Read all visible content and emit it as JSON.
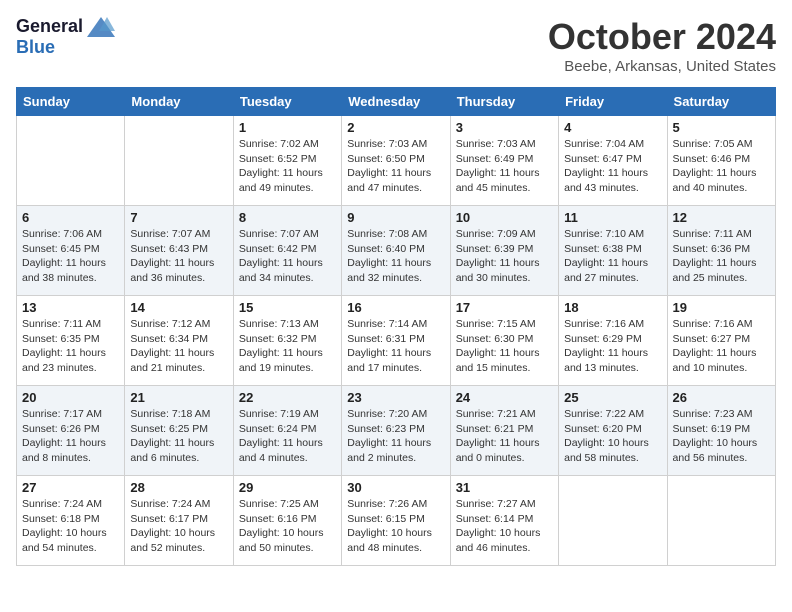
{
  "header": {
    "logo_general": "General",
    "logo_blue": "Blue",
    "month": "October 2024",
    "location": "Beebe, Arkansas, United States"
  },
  "days_of_week": [
    "Sunday",
    "Monday",
    "Tuesday",
    "Wednesday",
    "Thursday",
    "Friday",
    "Saturday"
  ],
  "weeks": [
    [
      {
        "day": "",
        "info": ""
      },
      {
        "day": "",
        "info": ""
      },
      {
        "day": "1",
        "info": "Sunrise: 7:02 AM\nSunset: 6:52 PM\nDaylight: 11 hours and 49 minutes."
      },
      {
        "day": "2",
        "info": "Sunrise: 7:03 AM\nSunset: 6:50 PM\nDaylight: 11 hours and 47 minutes."
      },
      {
        "day": "3",
        "info": "Sunrise: 7:03 AM\nSunset: 6:49 PM\nDaylight: 11 hours and 45 minutes."
      },
      {
        "day": "4",
        "info": "Sunrise: 7:04 AM\nSunset: 6:47 PM\nDaylight: 11 hours and 43 minutes."
      },
      {
        "day": "5",
        "info": "Sunrise: 7:05 AM\nSunset: 6:46 PM\nDaylight: 11 hours and 40 minutes."
      }
    ],
    [
      {
        "day": "6",
        "info": "Sunrise: 7:06 AM\nSunset: 6:45 PM\nDaylight: 11 hours and 38 minutes."
      },
      {
        "day": "7",
        "info": "Sunrise: 7:07 AM\nSunset: 6:43 PM\nDaylight: 11 hours and 36 minutes."
      },
      {
        "day": "8",
        "info": "Sunrise: 7:07 AM\nSunset: 6:42 PM\nDaylight: 11 hours and 34 minutes."
      },
      {
        "day": "9",
        "info": "Sunrise: 7:08 AM\nSunset: 6:40 PM\nDaylight: 11 hours and 32 minutes."
      },
      {
        "day": "10",
        "info": "Sunrise: 7:09 AM\nSunset: 6:39 PM\nDaylight: 11 hours and 30 minutes."
      },
      {
        "day": "11",
        "info": "Sunrise: 7:10 AM\nSunset: 6:38 PM\nDaylight: 11 hours and 27 minutes."
      },
      {
        "day": "12",
        "info": "Sunrise: 7:11 AM\nSunset: 6:36 PM\nDaylight: 11 hours and 25 minutes."
      }
    ],
    [
      {
        "day": "13",
        "info": "Sunrise: 7:11 AM\nSunset: 6:35 PM\nDaylight: 11 hours and 23 minutes."
      },
      {
        "day": "14",
        "info": "Sunrise: 7:12 AM\nSunset: 6:34 PM\nDaylight: 11 hours and 21 minutes."
      },
      {
        "day": "15",
        "info": "Sunrise: 7:13 AM\nSunset: 6:32 PM\nDaylight: 11 hours and 19 minutes."
      },
      {
        "day": "16",
        "info": "Sunrise: 7:14 AM\nSunset: 6:31 PM\nDaylight: 11 hours and 17 minutes."
      },
      {
        "day": "17",
        "info": "Sunrise: 7:15 AM\nSunset: 6:30 PM\nDaylight: 11 hours and 15 minutes."
      },
      {
        "day": "18",
        "info": "Sunrise: 7:16 AM\nSunset: 6:29 PM\nDaylight: 11 hours and 13 minutes."
      },
      {
        "day": "19",
        "info": "Sunrise: 7:16 AM\nSunset: 6:27 PM\nDaylight: 11 hours and 10 minutes."
      }
    ],
    [
      {
        "day": "20",
        "info": "Sunrise: 7:17 AM\nSunset: 6:26 PM\nDaylight: 11 hours and 8 minutes."
      },
      {
        "day": "21",
        "info": "Sunrise: 7:18 AM\nSunset: 6:25 PM\nDaylight: 11 hours and 6 minutes."
      },
      {
        "day": "22",
        "info": "Sunrise: 7:19 AM\nSunset: 6:24 PM\nDaylight: 11 hours and 4 minutes."
      },
      {
        "day": "23",
        "info": "Sunrise: 7:20 AM\nSunset: 6:23 PM\nDaylight: 11 hours and 2 minutes."
      },
      {
        "day": "24",
        "info": "Sunrise: 7:21 AM\nSunset: 6:21 PM\nDaylight: 11 hours and 0 minutes."
      },
      {
        "day": "25",
        "info": "Sunrise: 7:22 AM\nSunset: 6:20 PM\nDaylight: 10 hours and 58 minutes."
      },
      {
        "day": "26",
        "info": "Sunrise: 7:23 AM\nSunset: 6:19 PM\nDaylight: 10 hours and 56 minutes."
      }
    ],
    [
      {
        "day": "27",
        "info": "Sunrise: 7:24 AM\nSunset: 6:18 PM\nDaylight: 10 hours and 54 minutes."
      },
      {
        "day": "28",
        "info": "Sunrise: 7:24 AM\nSunset: 6:17 PM\nDaylight: 10 hours and 52 minutes."
      },
      {
        "day": "29",
        "info": "Sunrise: 7:25 AM\nSunset: 6:16 PM\nDaylight: 10 hours and 50 minutes."
      },
      {
        "day": "30",
        "info": "Sunrise: 7:26 AM\nSunset: 6:15 PM\nDaylight: 10 hours and 48 minutes."
      },
      {
        "day": "31",
        "info": "Sunrise: 7:27 AM\nSunset: 6:14 PM\nDaylight: 10 hours and 46 minutes."
      },
      {
        "day": "",
        "info": ""
      },
      {
        "day": "",
        "info": ""
      }
    ]
  ]
}
